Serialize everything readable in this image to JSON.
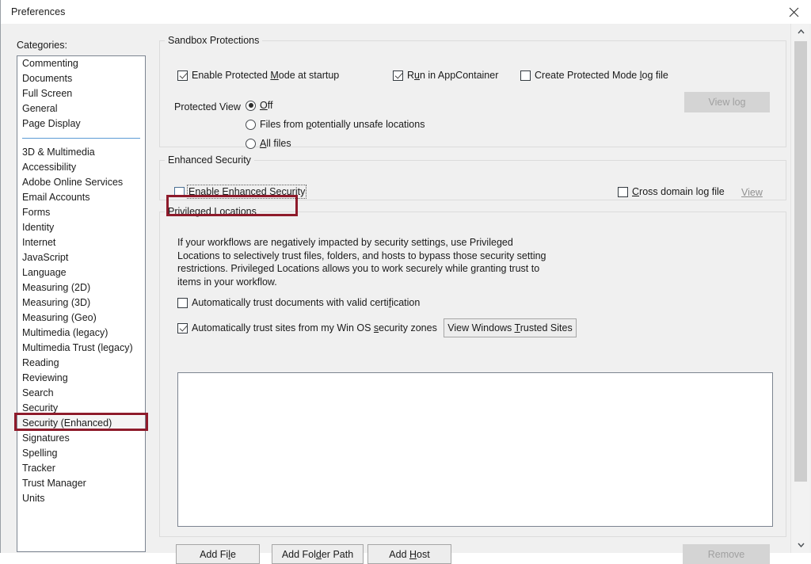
{
  "window": {
    "title": "Preferences",
    "close_icon": "close-icon"
  },
  "sidebar": {
    "label": "Categories:",
    "primary_items": [
      "Commenting",
      "Documents",
      "Full Screen",
      "General",
      "Page Display"
    ],
    "secondary_items": [
      "3D & Multimedia",
      "Accessibility",
      "Adobe Online Services",
      "Email Accounts",
      "Forms",
      "Identity",
      "Internet",
      "JavaScript",
      "Language",
      "Measuring (2D)",
      "Measuring (3D)",
      "Measuring (Geo)",
      "Multimedia (legacy)",
      "Multimedia Trust (legacy)",
      "Reading",
      "Reviewing",
      "Search",
      "Security",
      "Security (Enhanced)",
      "Signatures",
      "Spelling",
      "Tracker",
      "Trust Manager",
      "Units"
    ],
    "selected": "Security (Enhanced)"
  },
  "sandbox": {
    "legend": "Sandbox Protections",
    "enable_protected_mode": {
      "label": "Enable Protected Mode at startup",
      "pre": "Enable Protected ",
      "accel": "M",
      "post": "ode at startup",
      "checked": true
    },
    "run_in_appcontainer": {
      "label": "Run in AppContainer",
      "pre": "R",
      "accel": "u",
      "post": "n in AppContainer",
      "checked": true
    },
    "create_log_file": {
      "label": "Create Protected Mode log file",
      "pre": "Create Protected Mode ",
      "accel": "l",
      "post": "og file",
      "checked": false
    },
    "view_log_button": {
      "label": "View log",
      "disabled": true
    },
    "protected_view_label": "Protected View",
    "protected_view_options": [
      {
        "label": "Off",
        "pre": "",
        "accel": "O",
        "post": "ff",
        "selected": true
      },
      {
        "label": "Files from potentially unsafe locations",
        "pre": "Files from ",
        "accel": "p",
        "post": "otentially unsafe locations",
        "selected": false
      },
      {
        "label": "All files",
        "pre": "",
        "accel": "A",
        "post": "ll files",
        "selected": false
      }
    ]
  },
  "enhanced_security": {
    "legend": "Enhanced Security",
    "enable": {
      "label": "Enable Enhanced Security",
      "pre": "",
      "accel": "E",
      "post": "nable Enhanced Security",
      "checked": false,
      "focused": true,
      "highlighted": true
    },
    "cross_domain_log": {
      "label": "Cross domain log file",
      "pre": "",
      "accel": "C",
      "post": "ross domain log file",
      "checked": false
    },
    "view_link": {
      "label": "View",
      "disabled": true
    }
  },
  "privileged_locations": {
    "legend": "Privileged Locations",
    "description": "If your workflows are negatively impacted by security settings, use Privileged Locations to selectively trust files, folders, and hosts to bypass those security setting restrictions. Privileged Locations allows you to work securely while granting trust to items in your workflow.",
    "auto_trust_documents": {
      "label": "Automatically trust documents with valid certification",
      "pre": "Automatically trust documents with valid certi",
      "accel": "f",
      "post": "ication",
      "checked": false
    },
    "auto_trust_sites": {
      "label": "Automatically trust sites from my Win OS security zones",
      "pre": "Automatically trust sites from my Win OS ",
      "accel": "s",
      "post": "ecurity zones",
      "checked": true
    },
    "view_trusted_sites_button": {
      "label": "View Windows Trusted Sites",
      "pre": "View Windows ",
      "accel": "T",
      "post": "rusted Sites",
      "disabled": false
    },
    "list_items": [],
    "buttons": [
      {
        "label": "Add File",
        "pre": "Add Fi",
        "accel": "l",
        "post": "e",
        "disabled": false,
        "name": "add-file-button"
      },
      {
        "label": "Add Folder Path",
        "pre": "Add Fol",
        "accel": "d",
        "post": "er Path",
        "disabled": false,
        "name": "add-folder-path-button"
      },
      {
        "label": "Add Host",
        "pre": "Add ",
        "accel": "H",
        "post": "ost",
        "disabled": false,
        "name": "add-host-button"
      },
      {
        "label": "Remove",
        "pre": "Remove",
        "accel": "",
        "post": "",
        "disabled": true,
        "name": "remove-button"
      }
    ]
  },
  "scrollbar": {
    "up_arrow": "chevron-up-icon",
    "down_arrow": "chevron-down-icon"
  },
  "colors": {
    "annotation": "#8e1b2b",
    "separator": "#5b9bd5",
    "window_bg": "#f0f0f0"
  }
}
